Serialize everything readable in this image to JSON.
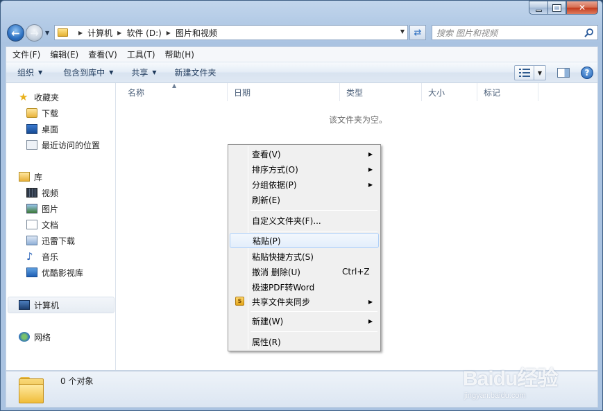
{
  "address": {
    "crumbs": [
      "计算机",
      "软件 (D:)",
      "图片和视频"
    ],
    "search_placeholder": "搜索 图片和视频"
  },
  "menubar": [
    "文件(F)",
    "编辑(E)",
    "查看(V)",
    "工具(T)",
    "帮助(H)"
  ],
  "commands": {
    "organize": "组织",
    "include_in_library": "包含到库中",
    "share": "共享",
    "new_folder": "新建文件夹"
  },
  "nav": {
    "favorites": "收藏夹",
    "downloads": "下载",
    "desktop": "桌面",
    "recent": "最近访问的位置",
    "libraries": "库",
    "videos": "视频",
    "pictures": "图片",
    "documents": "文档",
    "xunlei": "迅雷下载",
    "music": "音乐",
    "youku": "优酷影视库",
    "computer": "计算机",
    "network": "网络"
  },
  "columns": [
    "名称",
    "日期",
    "类型",
    "大小",
    "标记"
  ],
  "empty_message": "该文件夹为空。",
  "status": {
    "count_text": "0 个对象"
  },
  "context_menu": {
    "view": "查看(V)",
    "sort_by": "排序方式(O)",
    "group_by": "分组依据(P)",
    "refresh": "刷新(E)",
    "customize": "自定义文件夹(F)...",
    "paste": "粘贴(P)",
    "paste_shortcut": "粘贴快捷方式(S)",
    "undo": "撤消 删除(U)",
    "undo_shortcut": "Ctrl+Z",
    "pdf_to_word": "极速PDF转Word",
    "shared_sync": "共享文件夹同步",
    "new": "新建(W)",
    "properties": "属性(R)"
  },
  "watermark": {
    "logo": "Baidu经验",
    "url": "jingyan.baidu.com"
  }
}
